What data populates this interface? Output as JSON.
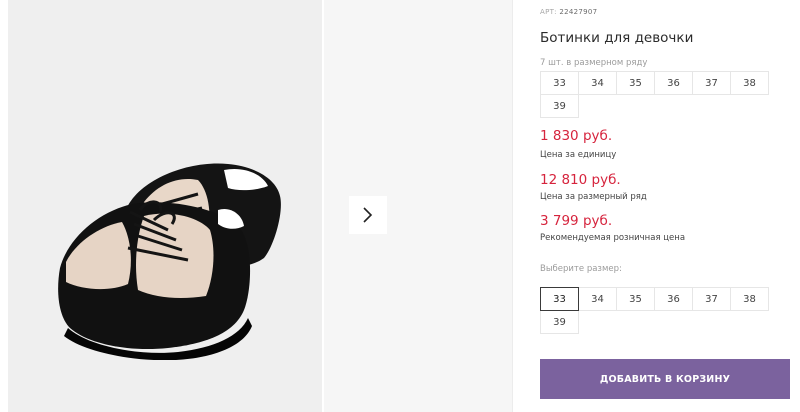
{
  "product": {
    "article_label": "АРТ:",
    "article_value": "22427907",
    "title": "Ботинки для девочки"
  },
  "size_row": {
    "label": "7 шт. в размерном ряду",
    "sizes": [
      "33",
      "34",
      "35",
      "36",
      "37",
      "38",
      "39"
    ]
  },
  "prices": {
    "unit_price": "1 830 руб.",
    "unit_caption": "Цена за единицу",
    "row_price": "12 810 руб.",
    "row_caption": "Цена за размерный ряд",
    "retail_price": "3 799 руб.",
    "retail_caption": "Рекомендуемая розничная цена"
  },
  "size_select": {
    "label": "Выберите размер:",
    "sizes": [
      "33",
      "34",
      "35",
      "36",
      "37",
      "38",
      "39"
    ],
    "selected": "33"
  },
  "cart": {
    "button_label": "ДОБАВИТЬ В КОРЗИНУ"
  },
  "gallery": {
    "next_icon": "chevron-right-icon"
  },
  "colors": {
    "price": "#d6243d",
    "button": "#7b629e"
  }
}
